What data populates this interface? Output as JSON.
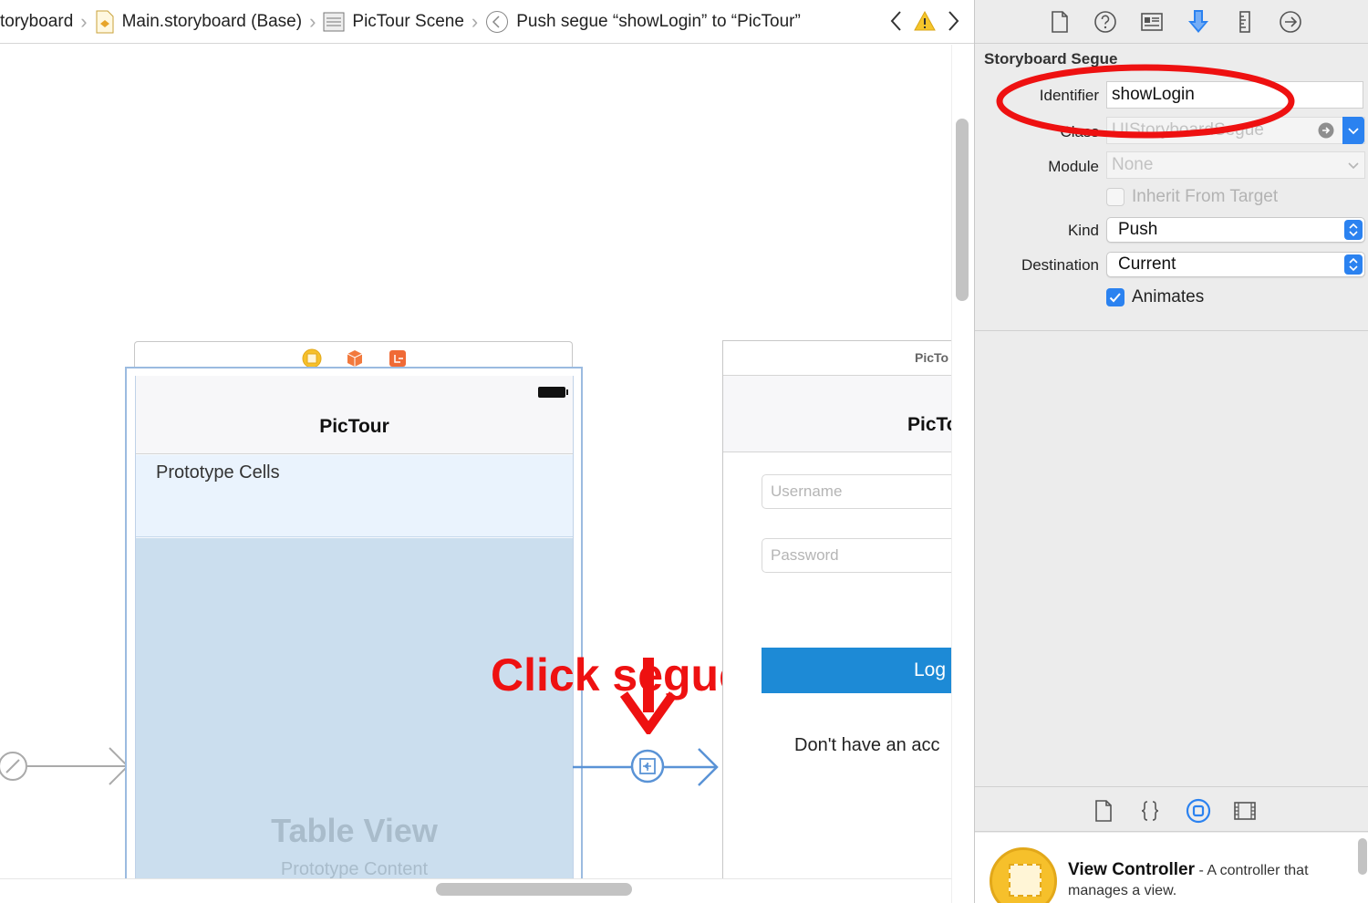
{
  "breadcrumb": {
    "items": [
      "toryboard",
      "Main.storyboard (Base)",
      "PicTour Scene",
      "Push segue “showLogin” to “PicTour”"
    ]
  },
  "canvas": {
    "scene1": {
      "title": "PicTour",
      "prototype_cells_label": "Prototype Cells",
      "table_view_label": "Table View",
      "prototype_content_label": "Prototype Content"
    },
    "scene2": {
      "header_label": "PicTo",
      "title": "PicTo",
      "username_placeholder": "Username",
      "password_placeholder": "Password",
      "login_button": "Log",
      "signup_text": "Don't have an acc"
    },
    "annotation": {
      "label": "Click segue",
      "color": "#ee1111"
    }
  },
  "inspector": {
    "section_title": "Storyboard Segue",
    "identifier_label": "Identifier",
    "identifier_value": "showLogin",
    "class_label": "Class",
    "class_placeholder": "UIStoryboardSegue",
    "module_label": "Module",
    "module_value": "None",
    "inherit_label": "Inherit From Target",
    "inherit_checked": false,
    "kind_label": "Kind",
    "kind_value": "Push",
    "destination_label": "Destination",
    "destination_value": "Current",
    "animates_label": "Animates",
    "animates_checked": true,
    "highlight_color": "#ee1111",
    "accent_color": "#2b82f0"
  },
  "library": {
    "item_name": "View Controller",
    "item_desc": " - A controller that manages a view."
  }
}
